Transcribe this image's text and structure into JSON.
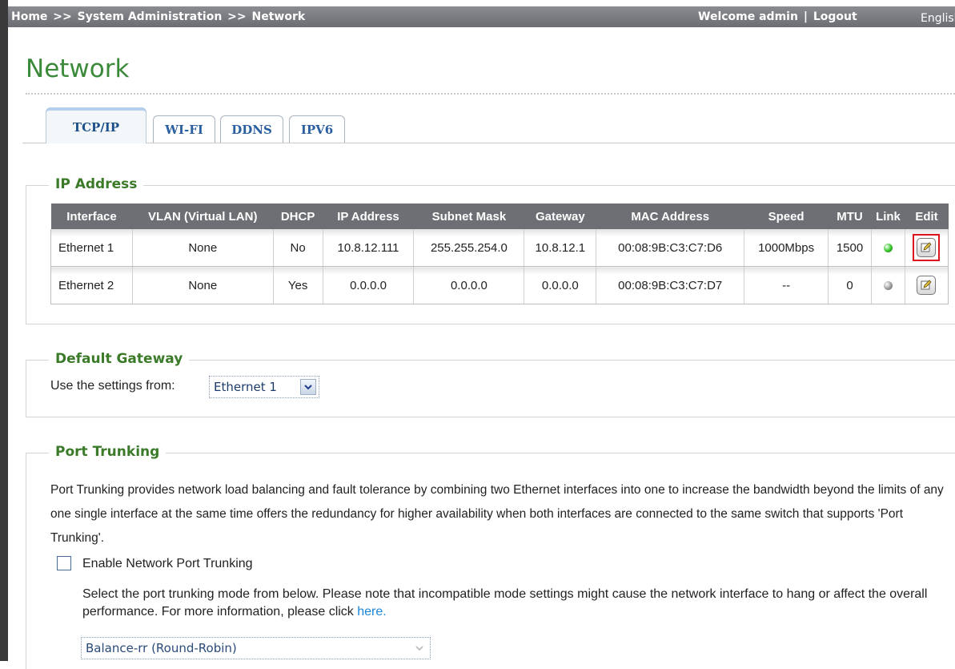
{
  "topbar": {
    "breadcrumb": [
      "Home",
      "System Administration",
      "Network"
    ],
    "breadcrumb_sep": ">>",
    "welcome": "Welcome admin",
    "divider": "|",
    "logout": "Logout",
    "language": "English"
  },
  "page_title": "Network",
  "tabs": [
    {
      "label": "TCP/IP",
      "active": true
    },
    {
      "label": "WI-FI",
      "active": false
    },
    {
      "label": "DDNS",
      "active": false
    },
    {
      "label": "IPV6",
      "active": false
    }
  ],
  "ip_address": {
    "legend": "IP Address",
    "columns": [
      "Interface",
      "VLAN (Virtual LAN)",
      "DHCP",
      "IP Address",
      "Subnet Mask",
      "Gateway",
      "MAC Address",
      "Speed",
      "MTU",
      "Link",
      "Edit"
    ],
    "rows": [
      {
        "interface": "Ethernet 1",
        "vlan": "None",
        "dhcp": "No",
        "ip": "10.8.12.111",
        "mask": "255.255.254.0",
        "gateway": "10.8.12.1",
        "mac": "00:08:9B:C3:C7:D6",
        "speed": "1000Mbps",
        "mtu": "1500",
        "link": "up",
        "link_color": "#2ec41e",
        "edit_highlighted": true
      },
      {
        "interface": "Ethernet 2",
        "vlan": "None",
        "dhcp": "Yes",
        "ip": "0.0.0.0",
        "mask": "0.0.0.0",
        "gateway": "0.0.0.0",
        "mac": "00:08:9B:C3:C7:D7",
        "speed": "--",
        "mtu": "0",
        "link": "down",
        "link_color": "#9a9a9a",
        "edit_highlighted": false
      }
    ]
  },
  "default_gateway": {
    "legend": "Default Gateway",
    "label": "Use the settings from:",
    "selected": "Ethernet 1"
  },
  "port_trunking": {
    "legend": "Port Trunking",
    "description": "Port Trunking provides network load balancing and fault tolerance by combining two Ethernet interfaces into one to increase the bandwidth beyond the limits of any one single interface at the same time offers the redundancy for higher availability when both interfaces are connected to the same switch that supports 'Port Trunking'.",
    "enable_label": "Enable Network Port Trunking",
    "enabled": false,
    "mode_note": "Select the port trunking mode from below. Please note that incompatible mode settings might cause the network interface to hang or affect the overall performance. For more information, please click",
    "mode_link": "here.",
    "mode_selected": "Balance-rr (Round-Robin)"
  },
  "colors": {
    "accent_green": "#3a8a3a",
    "header_gray": "#6d6f74",
    "link_blue": "#1a86d8",
    "highlight_red": "#e0141e"
  }
}
